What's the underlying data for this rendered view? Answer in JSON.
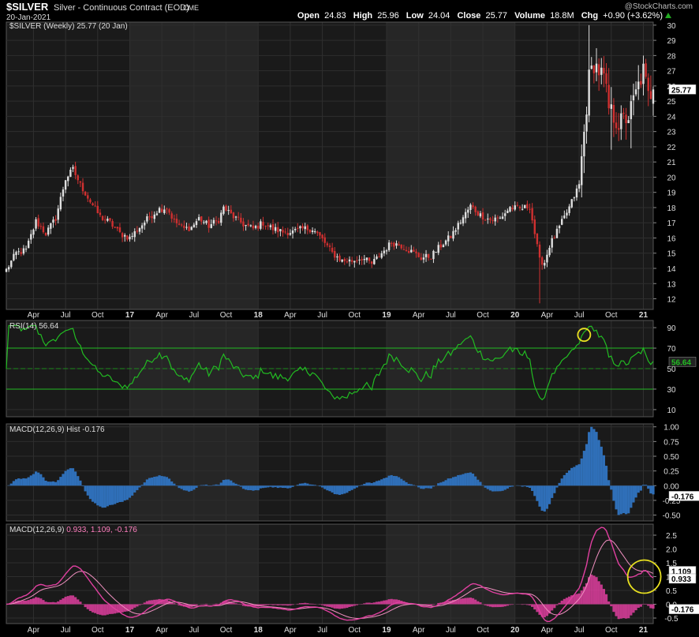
{
  "header": {
    "symbol": "$SILVER",
    "description": "Silver - Continuous Contract (EOD)",
    "exchange": "CME",
    "date": "20-Jan-2021",
    "watermark": "@StockCharts.com",
    "open_label": "Open",
    "open": "24.83",
    "high_label": "High",
    "high": "25.96",
    "low_label": "Low",
    "low": "24.04",
    "close_label": "Close",
    "close": "25.77",
    "volume_label": "Volume",
    "volume": "18.8M",
    "chg_label": "Chg",
    "chg": "+0.90 (+3.62%)"
  },
  "colors": {
    "background": "#000000",
    "panel": "#1a1a1a",
    "panel_alt": "#262626",
    "up_candle": "#e0e0e0",
    "down_candle": "#d03030",
    "rsi_line": "#22bb22",
    "macd_hist": "#2f6fb8",
    "macd_line": "#e040a0",
    "signal_line": "#f090c0",
    "annotation": "#e8e020"
  },
  "chart_data": [
    {
      "type": "candlestick",
      "panel": "price",
      "legend": "$SILVER (Weekly) 25.77 (20 Jan)",
      "last_value_label": "25.77",
      "ylim": [
        11.3,
        30.2
      ],
      "y_ticks": [
        12,
        13,
        14,
        15,
        16,
        17,
        18,
        19,
        20,
        21,
        22,
        23,
        24,
        25,
        26,
        27,
        28,
        29,
        30
      ],
      "x_ticks": [
        {
          "label": "Apr",
          "week": 11
        },
        {
          "label": "Jul",
          "week": 24
        },
        {
          "label": "Oct",
          "week": 37
        },
        {
          "label": "17",
          "week": 50
        },
        {
          "label": "Apr",
          "week": 63
        },
        {
          "label": "Jul",
          "week": 76
        },
        {
          "label": "Oct",
          "week": 89
        },
        {
          "label": "18",
          "week": 102
        },
        {
          "label": "Apr",
          "week": 115
        },
        {
          "label": "Jul",
          "week": 128
        },
        {
          "label": "Oct",
          "week": 141
        },
        {
          "label": "19",
          "week": 154
        },
        {
          "label": "Apr",
          "week": 167
        },
        {
          "label": "Jul",
          "week": 180
        },
        {
          "label": "Oct",
          "week": 193
        },
        {
          "label": "20",
          "week": 206
        },
        {
          "label": "Apr",
          "week": 219
        },
        {
          "label": "Jul",
          "week": 232
        },
        {
          "label": "Oct",
          "week": 245
        },
        {
          "label": "21",
          "week": 258
        }
      ],
      "weeks": 262,
      "close_anchors": [
        [
          0,
          13.9
        ],
        [
          4,
          15.0
        ],
        [
          8,
          15.2
        ],
        [
          12,
          17.1
        ],
        [
          16,
          16.3
        ],
        [
          20,
          17.3
        ],
        [
          24,
          19.9
        ],
        [
          27,
          20.5
        ],
        [
          30,
          19.5
        ],
        [
          34,
          18.4
        ],
        [
          38,
          17.4
        ],
        [
          42,
          17.0
        ],
        [
          46,
          16.3
        ],
        [
          50,
          16.0
        ],
        [
          54,
          16.7
        ],
        [
          58,
          17.4
        ],
        [
          62,
          17.9
        ],
        [
          65,
          18.0
        ],
        [
          68,
          17.1
        ],
        [
          72,
          16.6
        ],
        [
          75,
          16.7
        ],
        [
          78,
          17.3
        ],
        [
          82,
          16.8
        ],
        [
          86,
          17.2
        ],
        [
          88,
          18.0
        ],
        [
          92,
          17.4
        ],
        [
          96,
          16.9
        ],
        [
          100,
          16.6
        ],
        [
          104,
          17.0
        ],
        [
          108,
          16.6
        ],
        [
          112,
          16.4
        ],
        [
          116,
          16.4
        ],
        [
          120,
          16.6
        ],
        [
          124,
          16.6
        ],
        [
          128,
          15.9
        ],
        [
          132,
          15.0
        ],
        [
          136,
          14.5
        ],
        [
          140,
          14.5
        ],
        [
          144,
          14.7
        ],
        [
          148,
          14.3
        ],
        [
          152,
          15.0
        ],
        [
          156,
          15.7
        ],
        [
          160,
          15.5
        ],
        [
          164,
          15.1
        ],
        [
          168,
          14.7
        ],
        [
          172,
          14.8
        ],
        [
          176,
          15.5
        ],
        [
          180,
          16.1
        ],
        [
          184,
          17.1
        ],
        [
          188,
          18.1
        ],
        [
          192,
          17.5
        ],
        [
          196,
          17.2
        ],
        [
          200,
          17.3
        ],
        [
          204,
          18.0
        ],
        [
          208,
          17.9
        ],
        [
          212,
          18.1
        ],
        [
          214,
          16.3
        ],
        [
          216,
          14.5
        ],
        [
          218,
          14.4
        ],
        [
          220,
          15.5
        ],
        [
          224,
          16.7
        ],
        [
          228,
          18.0
        ],
        [
          232,
          19.5
        ],
        [
          234,
          22.9
        ],
        [
          236,
          26.5
        ],
        [
          238,
          27.5
        ],
        [
          242,
          26.5
        ],
        [
          244,
          24.5
        ],
        [
          248,
          23.5
        ],
        [
          252,
          24.0
        ],
        [
          256,
          26.0
        ],
        [
          258,
          27.0
        ],
        [
          260,
          25.3
        ],
        [
          262,
          25.77
        ]
      ],
      "spikes": [
        {
          "week": 216,
          "low": 11.7
        },
        {
          "week": 236,
          "high": 30.0
        },
        {
          "week": 245,
          "low": 21.8
        },
        {
          "week": 253,
          "low": 21.9
        },
        {
          "week": 258,
          "high": 28.0
        }
      ]
    },
    {
      "type": "line",
      "panel": "rsi",
      "legend": "RSI(14) 56.64",
      "last_value_label": "56.64",
      "ylim": [
        3,
        97
      ],
      "y_ticks": [
        10,
        30,
        50,
        70,
        90
      ],
      "reference_lines": [
        30,
        50,
        70
      ],
      "annotation_circle": {
        "week": 234,
        "value": 83
      }
    },
    {
      "type": "bar",
      "panel": "macd_histogram",
      "legend": "MACD(12,26,9) Hist -0.176",
      "last_value_label": "-0.176",
      "ylim": [
        -0.6,
        1.05
      ],
      "y_ticks": [
        -0.5,
        -0.25,
        0,
        0.25,
        0.5,
        0.75,
        1.0
      ],
      "y_tick_labels": [
        "-0.50",
        "-0.25",
        "0.00",
        "0.25",
        "0.50",
        "0.75",
        "1.00"
      ]
    },
    {
      "type": "line",
      "panel": "macd",
      "legend_label": "MACD(12,26,9)",
      "legend_values": "0.933, 1.109, -0.176",
      "last_value_labels": [
        "1.109",
        "0.933",
        "-0.176"
      ],
      "ylim": [
        -0.7,
        2.9
      ],
      "y_ticks": [
        -0.5,
        0,
        0.5,
        1.0,
        1.5,
        2.0,
        2.5
      ],
      "y_tick_labels": [
        "-0.5",
        "0.0",
        "0.5",
        "1.0",
        "1.5",
        "2.0",
        "2.5"
      ],
      "annotation_circle": {
        "week": 259,
        "value": 1.0
      }
    }
  ]
}
